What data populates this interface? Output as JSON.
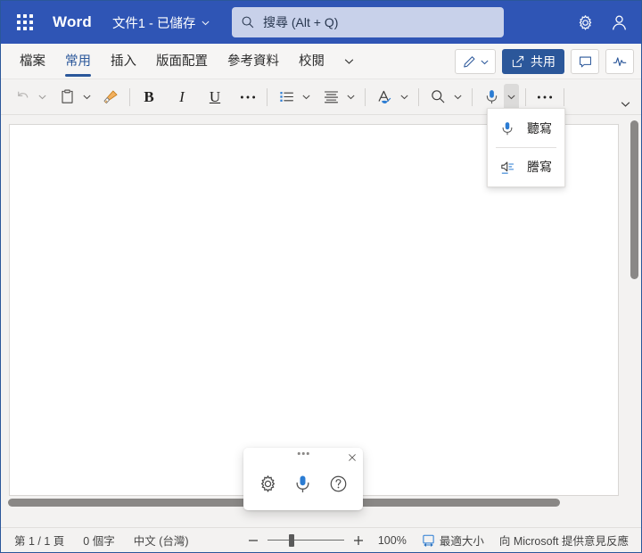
{
  "titlebar": {
    "app_launcher": "app-launcher",
    "app_name": "Word",
    "document_title": "文件1 - 已儲存",
    "search_placeholder": "搜尋 (Alt + Q)",
    "settings_label": "設定",
    "account_label": "帳戶",
    "bar_color": "#2f55b5"
  },
  "ribbon": {
    "tabs": [
      {
        "label": "檔案",
        "active": false
      },
      {
        "label": "常用",
        "active": true
      },
      {
        "label": "插入",
        "active": false
      },
      {
        "label": "版面配置",
        "active": false
      },
      {
        "label": "參考資料",
        "active": false
      },
      {
        "label": "校閱",
        "active": false
      }
    ],
    "more_tabs_icon": "chevron-down-icon",
    "editing_mode_label": "編輯",
    "share_label": "共用",
    "comments_label": "註解",
    "catch_up_label": "活動",
    "accent_color": "#2b579a"
  },
  "toolbar": {
    "undo_label": "復原",
    "paste_label": "貼上",
    "format_painter_label": "複製格式",
    "bold_label": "B",
    "italic_label": "I",
    "underline_label": "U",
    "more_font_label": "...",
    "bullets_label": "項目符號",
    "align_label": "對齊",
    "styles_label": "樣式",
    "find_label": "尋找",
    "dictate_label": "聽寫",
    "more_label": "...",
    "collapse_label": "摺疊功能區"
  },
  "dictate_menu": {
    "items": [
      {
        "label": "聽寫",
        "icon": "microphone-icon"
      },
      {
        "label": "謄寫",
        "icon": "transcribe-icon"
      }
    ]
  },
  "dictation_bar": {
    "settings_label": "設定",
    "mic_label": "聽寫",
    "help_label": "說明",
    "close_label": "×",
    "mic_color": "#2b7cd3"
  },
  "statusbar": {
    "page_info": "第 1 / 1 頁",
    "word_count": "0 個字",
    "language": "中文 (台灣)",
    "zoom_minus": "−",
    "zoom_plus": "+",
    "zoom_level": "100%",
    "fit_label": "最適大小",
    "feedback_label": "向 Microsoft 提供意見反應",
    "zoom_value": 100
  }
}
